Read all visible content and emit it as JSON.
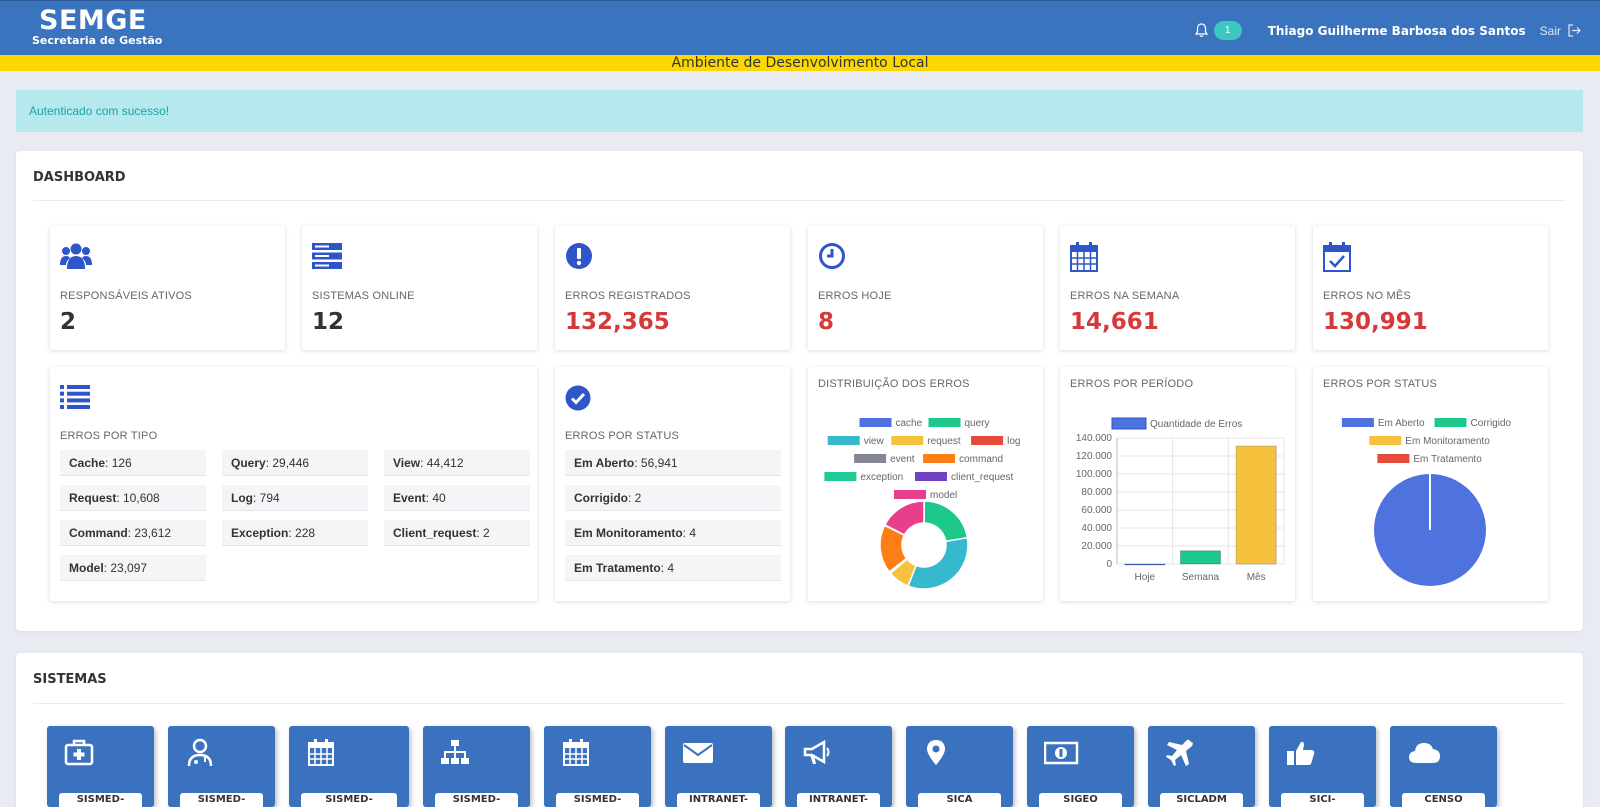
{
  "header": {
    "brand_title": "SEMGE",
    "brand_subtitle": "Secretaria de Gestão",
    "notifications_count": "1",
    "user_name": "Thiago Guilherme Barbosa dos Santos",
    "logout_label": "Sair"
  },
  "environment_banner": "Ambiente de Desenvolvimento Local",
  "alert": "Autenticado com sucesso!",
  "dashboard": {
    "title": "DASHBOARD",
    "stats": [
      {
        "label": "RESPONSÁVEIS ATIVOS",
        "value": "2",
        "icon": "users-icon"
      },
      {
        "label": "SISTEMAS ONLINE",
        "value": "12",
        "icon": "server-icon"
      },
      {
        "label": "ERROS REGISTRADOS",
        "value": "132,365",
        "icon": "exclamation-circle-icon"
      },
      {
        "label": "ERROS HOJE",
        "value": "8",
        "icon": "clock-icon"
      },
      {
        "label": "ERROS NA SEMANA",
        "value": "14,661",
        "icon": "calendar-icon"
      },
      {
        "label": "ERROS NO MÊS",
        "value": "130,991",
        "icon": "calendar-check-icon"
      }
    ],
    "erros_por_tipo": {
      "title": "ERROS POR TIPO",
      "items": [
        {
          "key": "Cache",
          "value": ": 126"
        },
        {
          "key": "Query",
          "value": ": 29,446"
        },
        {
          "key": "View",
          "value": ": 44,412"
        },
        {
          "key": "Request",
          "value": ": 10,608"
        },
        {
          "key": "Log",
          "value": ": 794"
        },
        {
          "key": "Event",
          "value": ": 40"
        },
        {
          "key": "Command",
          "value": ": 23,612"
        },
        {
          "key": "Exception",
          "value": ": 228"
        },
        {
          "key": "Client_request",
          "value": ": 2"
        },
        {
          "key": "Model",
          "value": ": 23,097"
        }
      ]
    },
    "erros_por_status": {
      "title": "ERROS POR STATUS",
      "items": [
        {
          "key": "Em Aberto",
          "value": ": 56,941"
        },
        {
          "key": "Corrigido",
          "value": ": 2"
        },
        {
          "key": "Em Monitoramento",
          "value": ": 4"
        },
        {
          "key": "Em Tratamento",
          "value": ": 4"
        }
      ]
    },
    "chart_titles": {
      "distribuicao": "DISTRIBUIÇÃO DOS ERROS",
      "periodo": "ERROS POR PERÍODO",
      "status": "ERROS POR STATUS"
    }
  },
  "chart_data": [
    {
      "type": "pie",
      "variant": "doughnut",
      "title": "DISTRIBUIÇÃO DOS ERROS",
      "categories": [
        "cache",
        "query",
        "view",
        "request",
        "log",
        "event",
        "command",
        "exception",
        "client_request",
        "model"
      ],
      "values": [
        126,
        29446,
        44412,
        10608,
        794,
        40,
        23612,
        228,
        2,
        23097
      ],
      "colors": [
        "#4e73df",
        "#1cc88a",
        "#36b9cc",
        "#f6c23e",
        "#e74a3b",
        "#858796",
        "#fd7e14",
        "#20c997",
        "#6f42c1",
        "#e83e8c"
      ],
      "legend": "top"
    },
    {
      "type": "bar",
      "title": "ERROS POR PERÍODO",
      "categories": [
        "Hoje",
        "Semana",
        "Mês"
      ],
      "series": [
        {
          "name": "Quantidade de Erros",
          "values": [
            8,
            14661,
            130991
          ]
        }
      ],
      "colors": [
        "#4e73df",
        "#1cc88a",
        "#f6c23e"
      ],
      "ylim": [
        0,
        140000
      ],
      "yticks": [
        "140.000",
        "120.000",
        "100.000",
        "80.000",
        "60.000",
        "40.000",
        "20.000",
        "0"
      ],
      "grid": true,
      "legend": "top"
    },
    {
      "type": "pie",
      "title": "ERROS POR STATUS",
      "categories": [
        "Em Aberto",
        "Corrigido",
        "Em Monitoramento",
        "Em Tratamento"
      ],
      "values": [
        56941,
        2,
        4,
        4
      ],
      "colors": [
        "#4e73df",
        "#1cc88a",
        "#f6c23e",
        "#e74a3b"
      ],
      "legend": "top"
    }
  ],
  "sistemas": {
    "title": "SISTEMAS",
    "tiles": [
      {
        "label": "SISMED-",
        "icon": "medkit-icon"
      },
      {
        "label": "SISMED-",
        "icon": "user-doctor-icon"
      },
      {
        "label": "SISMED-",
        "icon": "calendar-icon"
      },
      {
        "label": "SISMED-",
        "icon": "sitemap-icon"
      },
      {
        "label": "SISMED-",
        "icon": "calendar-icon"
      },
      {
        "label": "INTRANET-",
        "icon": "envelope-icon"
      },
      {
        "label": "INTRANET-",
        "icon": "bullhorn-icon"
      },
      {
        "label": "SICA",
        "icon": "map-marker-icon"
      },
      {
        "label": "SIGEO",
        "icon": "money-bill-icon"
      },
      {
        "label": "SICLADM",
        "icon": "plane-icon"
      },
      {
        "label": "SICI-",
        "icon": "thumbs-up-icon"
      },
      {
        "label": "CENSO",
        "icon": "cloud-icon"
      }
    ]
  },
  "colors": {
    "header_blue": "#3a74bf",
    "env_yellow": "#fdd700",
    "alert_bg": "#b5e9ee",
    "stat_red": "#d43a3a",
    "icon_blue": "#2f56c9"
  }
}
